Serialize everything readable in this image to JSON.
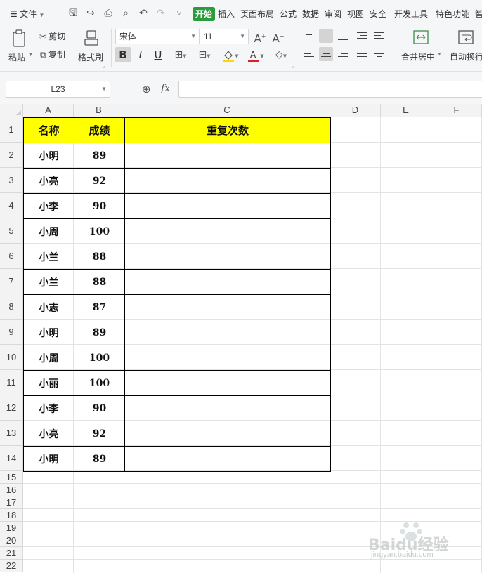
{
  "menubar": {
    "file_label": "文件",
    "tabs": [
      "开始",
      "插入",
      "页面布局",
      "公式",
      "数据",
      "审阅",
      "视图",
      "安全",
      "开发工具",
      "特色功能",
      "智"
    ],
    "active_tab": "开始"
  },
  "ribbon": {
    "paste_label": "粘贴",
    "cut_label": "剪切",
    "copy_label": "复制",
    "format_painter_label": "格式刷",
    "font_name": "宋体",
    "font_size": "11",
    "bold_label": "B",
    "italic_label": "I",
    "underline_label": "U",
    "merge_center_label": "合并居中",
    "auto_wrap_label": "自动换行"
  },
  "formula_bar": {
    "cell_reference": "L23",
    "fx_label": "fx",
    "formula_value": ""
  },
  "sheet": {
    "column_headers": [
      "A",
      "B",
      "C",
      "D",
      "E",
      "F"
    ],
    "row_headers": [
      "1",
      "2",
      "3",
      "4",
      "5",
      "6",
      "7",
      "8",
      "9",
      "10",
      "11",
      "12",
      "13",
      "14",
      "15",
      "16",
      "17",
      "18",
      "19",
      "20",
      "21",
      "22"
    ],
    "table_header": [
      "名称",
      "成绩",
      "重复次数"
    ],
    "rows": [
      [
        "小明",
        "89",
        ""
      ],
      [
        "小亮",
        "92",
        ""
      ],
      [
        "小李",
        "90",
        ""
      ],
      [
        "小周",
        "100",
        ""
      ],
      [
        "小兰",
        "88",
        ""
      ],
      [
        "小兰",
        "88",
        ""
      ],
      [
        "小志",
        "87",
        ""
      ],
      [
        "小明",
        "89",
        ""
      ],
      [
        "小周",
        "100",
        ""
      ],
      [
        "小丽",
        "100",
        ""
      ],
      [
        "小李",
        "90",
        ""
      ],
      [
        "小亮",
        "92",
        ""
      ],
      [
        "小明",
        "89",
        ""
      ]
    ],
    "header_fill_color": "#ffff00"
  },
  "watermark": {
    "brand": "Baidu经验",
    "url": "jingyan.baidu.com"
  }
}
